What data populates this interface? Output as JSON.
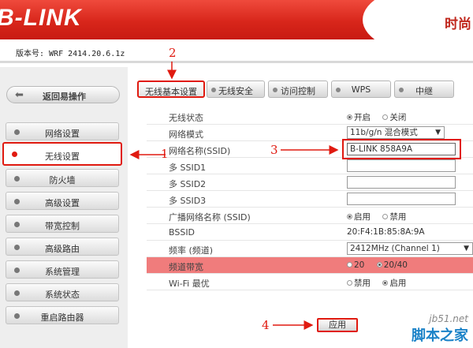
{
  "header": {
    "logo": "B-LINK",
    "brand_right": "时尚",
    "firmware": "版本号: WRF 2414.20.6.1z"
  },
  "sidebar": {
    "back_label": "返回易操作",
    "items": [
      {
        "label": "网络设置"
      },
      {
        "label": "无线设置"
      },
      {
        "label": "防火墙"
      },
      {
        "label": "高级设置"
      },
      {
        "label": "带宽控制"
      },
      {
        "label": "高级路由"
      },
      {
        "label": "系统管理"
      },
      {
        "label": "系统状态"
      },
      {
        "label": "重启路由器"
      }
    ],
    "active_index": 1
  },
  "tabs": [
    {
      "label": "无线基本设置"
    },
    {
      "label": "无线安全"
    },
    {
      "label": "访问控制"
    },
    {
      "label": "WPS"
    },
    {
      "label": "中继"
    }
  ],
  "form": {
    "wireless_status": {
      "label": "无线状态",
      "opt_on": "开启",
      "opt_off": "关闭",
      "selected": "开启"
    },
    "network_mode": {
      "label": "网络模式",
      "value": "11b/g/n 混合模式"
    },
    "ssid": {
      "label": "网络名称(SSID)",
      "value": "B-LINK 858A9A"
    },
    "ssid1": {
      "label": "多 SSID1",
      "value": ""
    },
    "ssid2": {
      "label": "多 SSID2",
      "value": ""
    },
    "ssid3": {
      "label": "多 SSID3",
      "value": ""
    },
    "broadcast": {
      "label": "广播网络名称 (SSID)",
      "opt_on": "启用",
      "opt_off": "禁用",
      "selected": "启用"
    },
    "bssid": {
      "label": "BSSID",
      "value": "20:F4:1B:85:8A:9A"
    },
    "channel": {
      "label": "频率 (频道)",
      "value": "2412MHz (Channel 1)"
    },
    "bandwidth": {
      "label": "频道带宽",
      "opt_a": "20",
      "opt_b": "20/40",
      "selected": "20/40"
    },
    "wifi_sched": {
      "label": "Wi-Fi 最优",
      "opt_off": "禁用",
      "opt_on": "启用",
      "selected": "启用"
    },
    "apply_label": "应用"
  },
  "annotations": {
    "n1": "1",
    "n2": "2",
    "n3": "3",
    "n4": "4"
  },
  "watermark": {
    "site": "jb51.net",
    "name": "脚本之家"
  },
  "colors": {
    "header_red": "#d8261b",
    "annotation_red": "#e01a10",
    "highlight_row": "#f07c7c"
  }
}
